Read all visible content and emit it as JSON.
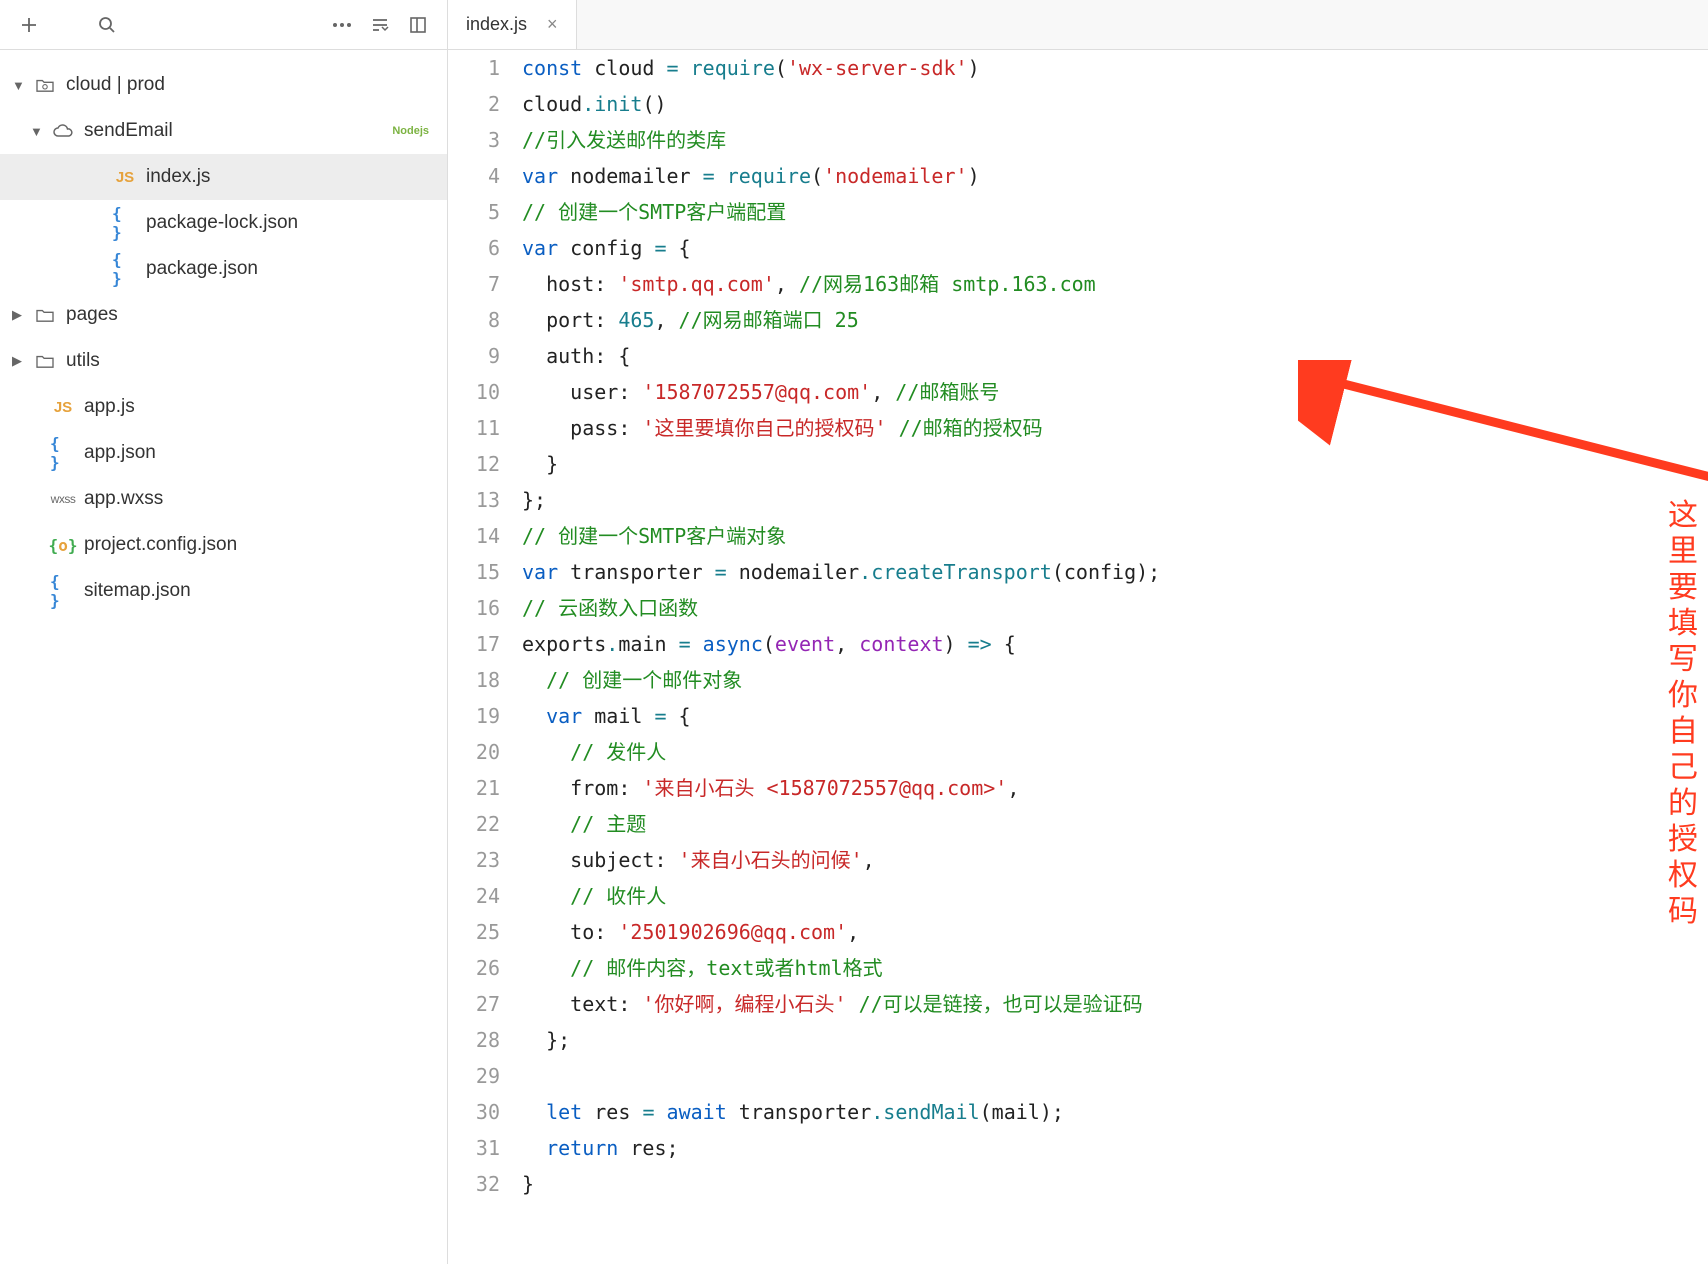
{
  "tab": {
    "title": "index.js"
  },
  "annotation": {
    "text": "这里要填写你自己的授权码"
  },
  "sidebar": {
    "tree": [
      {
        "indent": 0,
        "arrow": "▼",
        "icon": "cloud-folder",
        "label": "cloud | prod",
        "selected": false
      },
      {
        "indent": 1,
        "arrow": "▼",
        "icon": "cloud",
        "label": "sendEmail",
        "selected": false,
        "badge": "Nodejs"
      },
      {
        "indent": 3,
        "arrow": "",
        "icon": "js",
        "label": "index.js",
        "selected": true
      },
      {
        "indent": 3,
        "arrow": "",
        "icon": "json",
        "label": "package-lock.json",
        "selected": false
      },
      {
        "indent": 3,
        "arrow": "",
        "icon": "json",
        "label": "package.json",
        "selected": false
      },
      {
        "indent": 0,
        "arrow": "▶",
        "icon": "folder",
        "label": "pages",
        "selected": false
      },
      {
        "indent": 0,
        "arrow": "▶",
        "icon": "folder",
        "label": "utils",
        "selected": false
      },
      {
        "indent": 1,
        "arrow": "",
        "icon": "js",
        "label": "app.js",
        "selected": false
      },
      {
        "indent": 1,
        "arrow": "",
        "icon": "json",
        "label": "app.json",
        "selected": false
      },
      {
        "indent": 1,
        "arrow": "",
        "icon": "wxss",
        "label": "app.wxss",
        "selected": false
      },
      {
        "indent": 1,
        "arrow": "",
        "icon": "json-g",
        "label": "project.config.json",
        "selected": false
      },
      {
        "indent": 1,
        "arrow": "",
        "icon": "json",
        "label": "sitemap.json",
        "selected": false
      }
    ]
  },
  "code": {
    "lineCount": 32,
    "lines": [
      [
        {
          "c": "k-blue",
          "t": "const"
        },
        {
          "t": " cloud "
        },
        {
          "c": "k-teal",
          "t": "="
        },
        {
          "t": " "
        },
        {
          "c": "k-teal",
          "t": "require"
        },
        {
          "t": "("
        },
        {
          "c": "k-red",
          "t": "'wx-server-sdk'"
        },
        {
          "t": ")"
        }
      ],
      [
        {
          "t": "cloud"
        },
        {
          "c": "k-teal",
          "t": "."
        },
        {
          "c": "k-teal",
          "t": "init"
        },
        {
          "t": "()"
        }
      ],
      [
        {
          "c": "k-green",
          "t": "//引入发送邮件的类库"
        }
      ],
      [
        {
          "c": "k-blue",
          "t": "var"
        },
        {
          "t": " nodemailer "
        },
        {
          "c": "k-teal",
          "t": "="
        },
        {
          "t": " "
        },
        {
          "c": "k-teal",
          "t": "require"
        },
        {
          "t": "("
        },
        {
          "c": "k-red",
          "t": "'nodemailer'"
        },
        {
          "t": ")"
        }
      ],
      [
        {
          "c": "k-green",
          "t": "// 创建一个SMTP客户端配置"
        }
      ],
      [
        {
          "c": "k-blue",
          "t": "var"
        },
        {
          "t": " config "
        },
        {
          "c": "k-teal",
          "t": "="
        },
        {
          "t": " {"
        }
      ],
      [
        {
          "t": "  host: "
        },
        {
          "c": "k-red",
          "t": "'smtp.qq.com'"
        },
        {
          "t": ", "
        },
        {
          "c": "k-green",
          "t": "//网易163邮箱 smtp.163.com"
        }
      ],
      [
        {
          "t": "  port: "
        },
        {
          "c": "k-teal",
          "t": "465"
        },
        {
          "t": ", "
        },
        {
          "c": "k-green",
          "t": "//网易邮箱端口 25"
        }
      ],
      [
        {
          "t": "  auth: {"
        }
      ],
      [
        {
          "t": "    user: "
        },
        {
          "c": "k-red",
          "t": "'1587072557@qq.com'"
        },
        {
          "t": ", "
        },
        {
          "c": "k-green",
          "t": "//邮箱账号"
        }
      ],
      [
        {
          "t": "    pass: "
        },
        {
          "c": "k-red",
          "t": "'这里要填你自己的授权码'"
        },
        {
          "t": " "
        },
        {
          "c": "k-green",
          "t": "//邮箱的授权码"
        }
      ],
      [
        {
          "t": "  }"
        }
      ],
      [
        {
          "t": "};"
        }
      ],
      [
        {
          "c": "k-green",
          "t": "// 创建一个SMTP客户端对象"
        }
      ],
      [
        {
          "c": "k-blue",
          "t": "var"
        },
        {
          "t": " transporter "
        },
        {
          "c": "k-teal",
          "t": "="
        },
        {
          "t": " nodemailer"
        },
        {
          "c": "k-teal",
          "t": "."
        },
        {
          "c": "k-teal",
          "t": "createTransport"
        },
        {
          "t": "(config);"
        }
      ],
      [
        {
          "c": "k-green",
          "t": "// 云函数入口函数"
        }
      ],
      [
        {
          "t": "exports"
        },
        {
          "c": "k-teal",
          "t": "."
        },
        {
          "t": "main "
        },
        {
          "c": "k-teal",
          "t": "="
        },
        {
          "t": " "
        },
        {
          "c": "k-blue",
          "t": "async"
        },
        {
          "t": "("
        },
        {
          "c": "k-purple",
          "t": "event"
        },
        {
          "t": ", "
        },
        {
          "c": "k-purple",
          "t": "context"
        },
        {
          "t": ") "
        },
        {
          "c": "k-teal",
          "t": "=>"
        },
        {
          "t": " {"
        }
      ],
      [
        {
          "t": "  "
        },
        {
          "c": "k-green",
          "t": "// 创建一个邮件对象"
        }
      ],
      [
        {
          "t": "  "
        },
        {
          "c": "k-blue",
          "t": "var"
        },
        {
          "t": " mail "
        },
        {
          "c": "k-teal",
          "t": "="
        },
        {
          "t": " {"
        }
      ],
      [
        {
          "t": "    "
        },
        {
          "c": "k-green",
          "t": "// 发件人"
        }
      ],
      [
        {
          "t": "    from: "
        },
        {
          "c": "k-red",
          "t": "'来自小石头 <1587072557@qq.com>'"
        },
        {
          "t": ","
        }
      ],
      [
        {
          "t": "    "
        },
        {
          "c": "k-green",
          "t": "// 主题"
        }
      ],
      [
        {
          "t": "    subject: "
        },
        {
          "c": "k-red",
          "t": "'来自小石头的问候'"
        },
        {
          "t": ","
        }
      ],
      [
        {
          "t": "    "
        },
        {
          "c": "k-green",
          "t": "// 收件人"
        }
      ],
      [
        {
          "t": "    to: "
        },
        {
          "c": "k-red",
          "t": "'2501902696@qq.com'"
        },
        {
          "t": ","
        }
      ],
      [
        {
          "t": "    "
        },
        {
          "c": "k-green",
          "t": "// 邮件内容，text或者html格式"
        }
      ],
      [
        {
          "t": "    text: "
        },
        {
          "c": "k-red",
          "t": "'你好啊，编程小石头'"
        },
        {
          "t": " "
        },
        {
          "c": "k-green",
          "t": "//可以是链接，也可以是验证码"
        }
      ],
      [
        {
          "t": "  };"
        }
      ],
      [
        {
          "t": ""
        }
      ],
      [
        {
          "t": "  "
        },
        {
          "c": "k-blue",
          "t": "let"
        },
        {
          "t": " res "
        },
        {
          "c": "k-teal",
          "t": "="
        },
        {
          "t": " "
        },
        {
          "c": "k-blue",
          "t": "await"
        },
        {
          "t": " transporter"
        },
        {
          "c": "k-teal",
          "t": "."
        },
        {
          "c": "k-teal",
          "t": "sendMail"
        },
        {
          "t": "(mail);"
        }
      ],
      [
        {
          "t": "  "
        },
        {
          "c": "k-blue",
          "t": "return"
        },
        {
          "t": " res;"
        }
      ],
      [
        {
          "t": "}"
        }
      ]
    ]
  }
}
